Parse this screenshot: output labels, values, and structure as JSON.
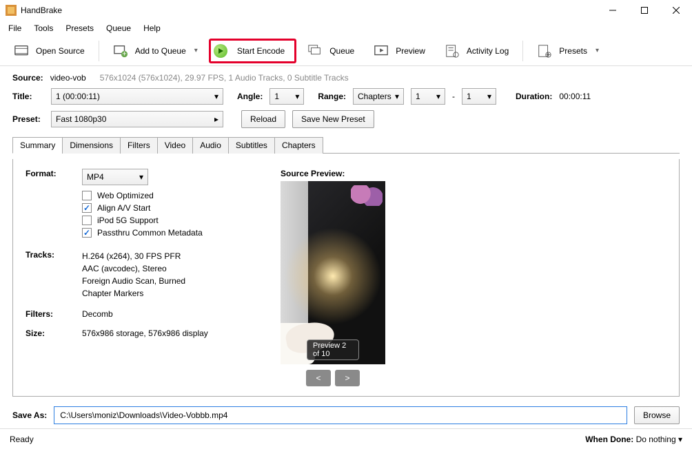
{
  "window": {
    "title": "HandBrake"
  },
  "menu": [
    "File",
    "Tools",
    "Presets",
    "Queue",
    "Help"
  ],
  "toolbar": {
    "open_source": "Open Source",
    "add_to_queue": "Add to Queue",
    "start_encode": "Start Encode",
    "queue": "Queue",
    "preview": "Preview",
    "activity_log": "Activity Log",
    "presets": "Presets"
  },
  "source": {
    "label": "Source:",
    "name": "video-vob",
    "meta": "576x1024 (576x1024), 29.97 FPS, 1 Audio Tracks, 0 Subtitle Tracks"
  },
  "title_row": {
    "title_label": "Title:",
    "title_value": "1  (00:00:11)",
    "angle_label": "Angle:",
    "angle_value": "1",
    "range_label": "Range:",
    "range_type": "Chapters",
    "range_from": "1",
    "range_sep": "-",
    "range_to": "1",
    "duration_label": "Duration:",
    "duration_value": "00:00:11"
  },
  "preset_row": {
    "label": "Preset:",
    "value": "Fast 1080p30",
    "reload": "Reload",
    "save_new": "Save New Preset"
  },
  "tabs": [
    "Summary",
    "Dimensions",
    "Filters",
    "Video",
    "Audio",
    "Subtitles",
    "Chapters"
  ],
  "summary": {
    "format_label": "Format:",
    "format_value": "MP4",
    "checks": {
      "web_optimized": "Web Optimized",
      "align_av": "Align A/V Start",
      "ipod": "iPod 5G Support",
      "passthru": "Passthru Common Metadata"
    },
    "tracks_label": "Tracks:",
    "tracks": [
      "H.264 (x264), 30 FPS PFR",
      "AAC (avcodec), Stereo",
      "Foreign Audio Scan, Burned",
      "Chapter Markers"
    ],
    "filters_label": "Filters:",
    "filters_value": "Decomb",
    "size_label": "Size:",
    "size_value": "576x986 storage, 576x986 display"
  },
  "preview": {
    "title": "Source Preview:",
    "badge": "Preview 2 of 10",
    "prev": "<",
    "next": ">"
  },
  "saveas": {
    "label": "Save As:",
    "path": "C:\\Users\\moniz\\Downloads\\Video-Vobbb.mp4",
    "browse": "Browse"
  },
  "status": {
    "ready": "Ready",
    "when_done_label": "When Done:",
    "when_done_value": "Do nothing"
  }
}
